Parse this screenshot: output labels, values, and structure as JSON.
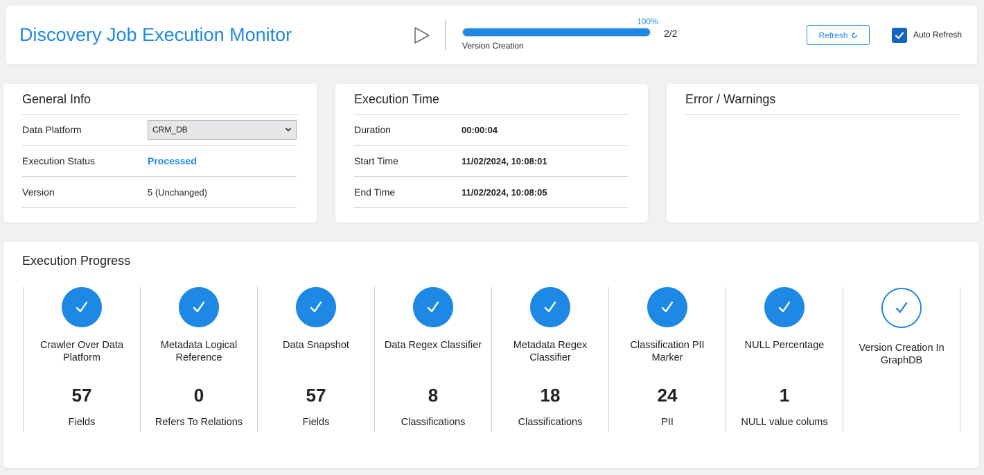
{
  "header": {
    "title": "Discovery Job Execution Monitor",
    "progress_percent_label": "100%",
    "progress_fraction": 1.0,
    "progress_count": "2/2",
    "progress_stage": "Version Creation",
    "refresh_label": "Refresh",
    "auto_refresh_label": "Auto Refresh",
    "auto_refresh_checked": true
  },
  "general_info": {
    "title": "General Info",
    "data_platform_label": "Data Platform",
    "data_platform_value": "CRM_DB",
    "execution_status_label": "Execution Status",
    "execution_status_value": "Processed",
    "version_label": "Version",
    "version_value": "5 (Unchanged)"
  },
  "execution_time": {
    "title": "Execution Time",
    "duration_label": "Duration",
    "duration_value": "00:00:04",
    "start_label": "Start Time",
    "start_value": "11/02/2024, 10:08:01",
    "end_label": "End Time",
    "end_value": "11/02/2024, 10:08:05"
  },
  "errors": {
    "title": "Error / Warnings"
  },
  "execution_progress": {
    "title": "Execution Progress",
    "steps": [
      {
        "name": "Crawler Over Data Platform",
        "count": "57",
        "unit": "Fields",
        "done": true
      },
      {
        "name": "Metadata Logical Reference",
        "count": "0",
        "unit": "Refers To Relations",
        "done": true
      },
      {
        "name": "Data Snapshot",
        "count": "57",
        "unit": "Fields",
        "done": true
      },
      {
        "name": "Data Regex Classifier",
        "count": "8",
        "unit": "Classifications",
        "done": true
      },
      {
        "name": "Metadata Regex Classifier",
        "count": "18",
        "unit": "Classifications",
        "done": true
      },
      {
        "name": "Classification PII Marker",
        "count": "24",
        "unit": "PII",
        "done": true
      },
      {
        "name": "NULL Percentage",
        "count": "1",
        "unit": "NULL value colums",
        "done": true
      },
      {
        "name": "Version Creation In GraphDB",
        "count": "",
        "unit": "",
        "done": true
      }
    ]
  },
  "colors": {
    "accent": "#1e88e5",
    "checkbox": "#1565c0"
  },
  "icons": {
    "play": "play-icon",
    "refresh": "refresh-icon",
    "check": "check-icon",
    "dropdown": "chevron-down-icon"
  }
}
